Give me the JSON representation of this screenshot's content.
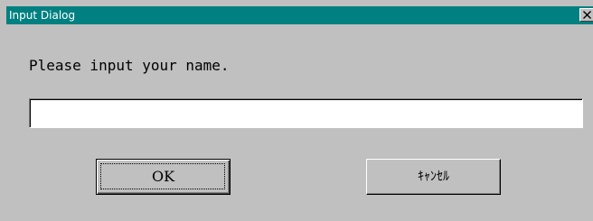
{
  "dialog": {
    "title": "Input Dialog",
    "prompt": "Please input your name.",
    "name_input": {
      "value": "",
      "placeholder": ""
    },
    "ok_label": "OK",
    "cancel_label": "ｷｬﾝｾﾙ",
    "close_icon": "close-icon"
  },
  "colors": {
    "titlebar": "#008080",
    "title_text": "#ffffff",
    "dialog_background": "#c0c0c0",
    "input_background": "#ffffff"
  }
}
